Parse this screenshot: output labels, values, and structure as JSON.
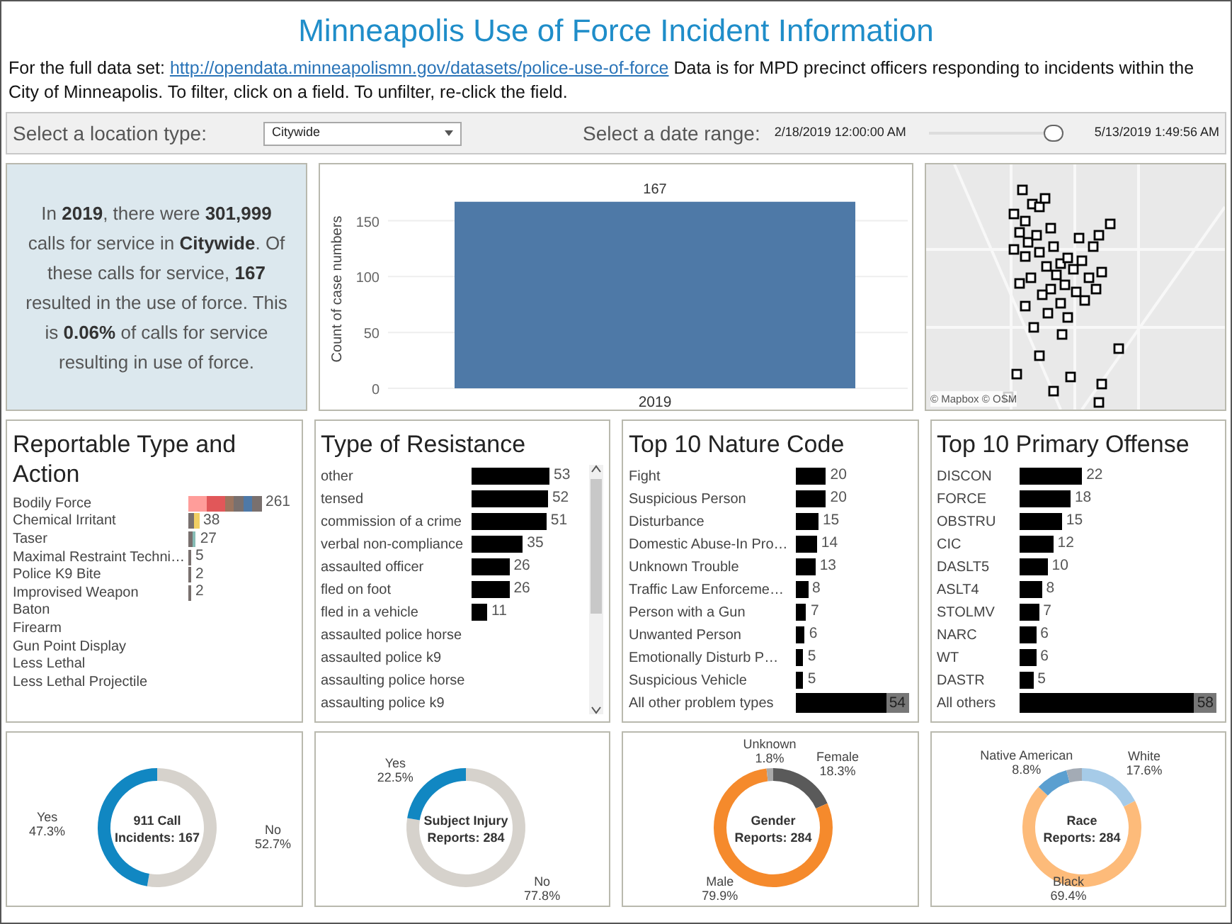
{
  "title": "Minneapolis Use of Force Incident Information",
  "description": {
    "before": "For the full data set:",
    "link": "http://opendata.minneapolismn.gov/datasets/police-use-of-force",
    "after": "Data is for MPD precinct officers responding to incidents within the City of Minneapolis.  To filter, click on a field.  To unfilter, re-click the field."
  },
  "filters": {
    "location_label": "Select a location type:",
    "location_value": "Citywide",
    "date_label": "Select a date range:",
    "date_start": "2/18/2019 12:00:00 AM",
    "date_end": "5/13/2019 1:49:56 AM",
    "date_slider": {
      "level": 0.93
    }
  },
  "summary": {
    "text": "In **2019**, there were **301,999** calls for service in **Citywide**.  Of these calls for service, **167** resulted in the use of force.  This is **0.06%** of calls for service resulting in use of force."
  },
  "count_chart": {
    "chart_data": {
      "type": "bar",
      "ylabel": "Count of case numbers",
      "categories": [
        "2019"
      ],
      "values": [
        167
      ],
      "yticks": [
        0,
        50,
        100,
        150
      ],
      "ylim": [
        0,
        170
      ],
      "grid": true,
      "data_labels": true
    }
  },
  "map": {
    "attribution": "© Mapbox © OSM"
  },
  "lists": [
    {
      "title": "Reportable Type and Action",
      "items": [
        {
          "label": "Bodily Force",
          "kind": "stacked",
          "value": "261",
          "segments": [
            {
              "color": "#ff9d9a"
            },
            {
              "color": "#ff9d9a"
            },
            {
              "color": "#e15759"
            },
            {
              "color": "#e15759"
            },
            {
              "color": "#9c755f"
            },
            {
              "color": "#79706e"
            },
            {
              "color": "#4e79a7"
            },
            {
              "color": "#79706e"
            }
          ]
        },
        {
          "label": "Chemical Irritant",
          "kind": "stacked",
          "value": "38",
          "segments": [
            {
              "color": "#79706e"
            },
            {
              "color": "#f1ce63"
            }
          ]
        },
        {
          "label": "Taser",
          "kind": "stacked",
          "value": "27",
          "segments": [
            {
              "color": "#79706e"
            },
            {
              "color": "#86bcb6"
            }
          ]
        },
        {
          "label": "Maximal Restraint Techni…",
          "kind": "stacked",
          "value": "5",
          "segments": [
            {
              "color": "#79706e"
            }
          ]
        },
        {
          "label": "Police K9 Bite",
          "kind": "stacked",
          "value": "2",
          "segments": [
            {
              "color": "#79706e"
            }
          ]
        },
        {
          "label": "Improvised Weapon",
          "kind": "stacked",
          "value": "2",
          "segments": [
            {
              "color": "#79706e"
            }
          ]
        },
        {
          "label": "Baton",
          "kind": "empty"
        },
        {
          "label": "Firearm",
          "kind": "empty"
        },
        {
          "label": "Gun Point Display",
          "kind": "empty"
        },
        {
          "label": "Less Lethal",
          "kind": "empty"
        },
        {
          "label": "Less Lethal Projectile",
          "kind": "empty"
        }
      ]
    },
    {
      "title": "Type of Resistance",
      "scrollbar": true,
      "items": [
        {
          "label": "other",
          "kind": "bar",
          "value": "53"
        },
        {
          "label": "tensed",
          "kind": "bar",
          "value": "52"
        },
        {
          "label": "commission of a crime",
          "kind": "bar",
          "value": "51"
        },
        {
          "label": "verbal non-compliance",
          "kind": "bar",
          "value": "35"
        },
        {
          "label": "assaulted officer",
          "kind": "bar",
          "value": "26"
        },
        {
          "label": "fled on foot",
          "kind": "bar",
          "value": "26"
        },
        {
          "label": "fled in a vehicle",
          "kind": "bar",
          "value": "11"
        },
        {
          "label": "assaulted police horse",
          "kind": "empty"
        },
        {
          "label": "assaulted police k9",
          "kind": "empty"
        },
        {
          "label": "assaulting police horse",
          "kind": "empty"
        },
        {
          "label": "assaulting police k9",
          "kind": "empty"
        }
      ]
    },
    {
      "title": "Top 10 Nature Code",
      "items": [
        {
          "label": "Fight",
          "kind": "bar",
          "value": "20"
        },
        {
          "label": "Suspicious Person",
          "kind": "bar",
          "value": "20"
        },
        {
          "label": "Disturbance",
          "kind": "bar",
          "value": "15"
        },
        {
          "label": "Domestic Abuse-In Pro…",
          "kind": "bar",
          "value": "14"
        },
        {
          "label": "Unknown Trouble",
          "kind": "bar",
          "value": "13"
        },
        {
          "label": "Traffic Law Enforceme…",
          "kind": "bar",
          "value": "8"
        },
        {
          "label": "Person with a Gun",
          "kind": "bar",
          "value": "7"
        },
        {
          "label": "Unwanted Person",
          "kind": "bar",
          "value": "6"
        },
        {
          "label": "Emotionally Disturb P…",
          "kind": "bar",
          "value": "5"
        },
        {
          "label": "Suspicious Vehicle",
          "kind": "bar",
          "value": "5"
        },
        {
          "label": "All other problem types",
          "kind": "total",
          "value": "54"
        }
      ]
    },
    {
      "title": "Top 10 Primary Offense",
      "items": [
        {
          "label": "DISCON",
          "kind": "bar",
          "value": "22"
        },
        {
          "label": "FORCE",
          "kind": "bar",
          "value": "18"
        },
        {
          "label": "OBSTRU",
          "kind": "bar",
          "value": "15"
        },
        {
          "label": "CIC",
          "kind": "bar",
          "value": "12"
        },
        {
          "label": "DASLT5",
          "kind": "bar",
          "value": "10"
        },
        {
          "label": "ASLT4",
          "kind": "bar",
          "value": "8"
        },
        {
          "label": "STOLMV",
          "kind": "bar",
          "value": "7"
        },
        {
          "label": "NARC",
          "kind": "bar",
          "value": "6"
        },
        {
          "label": "WT",
          "kind": "bar",
          "value": "6"
        },
        {
          "label": "DASTR",
          "kind": "bar",
          "value": "5"
        },
        {
          "label": "All others",
          "kind": "total",
          "value": "58"
        }
      ]
    }
  ],
  "donuts": [
    {
      "center_label": [
        "911 Call",
        "Incidents: 167"
      ],
      "chart_data": {
        "type": "donut",
        "categories": [
          "No",
          "Yes"
        ],
        "values": [
          52.7,
          47.3
        ],
        "value_labels": [
          "52.7%",
          "47.3%"
        ],
        "colors": [
          "#d6d2cc",
          "#1187c2"
        ]
      }
    },
    {
      "center_label": [
        "Subject Injury",
        "Reports: 284"
      ],
      "chart_data": {
        "type": "donut",
        "categories": [
          "No",
          "Yes"
        ],
        "values": [
          77.8,
          22.5
        ],
        "value_labels": [
          "77.8%",
          "22.5%"
        ],
        "colors": [
          "#d6d2cc",
          "#1187c2"
        ]
      }
    },
    {
      "center_label": [
        "Gender",
        "Reports: 284"
      ],
      "chart_data": {
        "type": "donut",
        "categories": [
          "Female",
          "Male",
          "Unknown"
        ],
        "values": [
          18.3,
          79.9,
          1.8
        ],
        "value_labels": [
          "18.3%",
          "79.9%",
          "1.8%"
        ],
        "colors": [
          "#5a5a5a",
          "#f58a2c",
          "#a9a9a9"
        ]
      }
    },
    {
      "center_label": [
        "Race",
        "Reports: 284"
      ],
      "chart_data": {
        "type": "donut",
        "categories": [
          "White",
          "Black",
          "Native American",
          null
        ],
        "values": [
          17.6,
          69.4,
          8.8,
          4.2
        ],
        "value_labels": [
          "17.6%",
          "69.4%",
          "8.8%",
          null
        ],
        "colors": [
          "#a6cbe8",
          "#fdbb7a",
          "#5b9fd0",
          "#a3abb5"
        ]
      }
    }
  ]
}
